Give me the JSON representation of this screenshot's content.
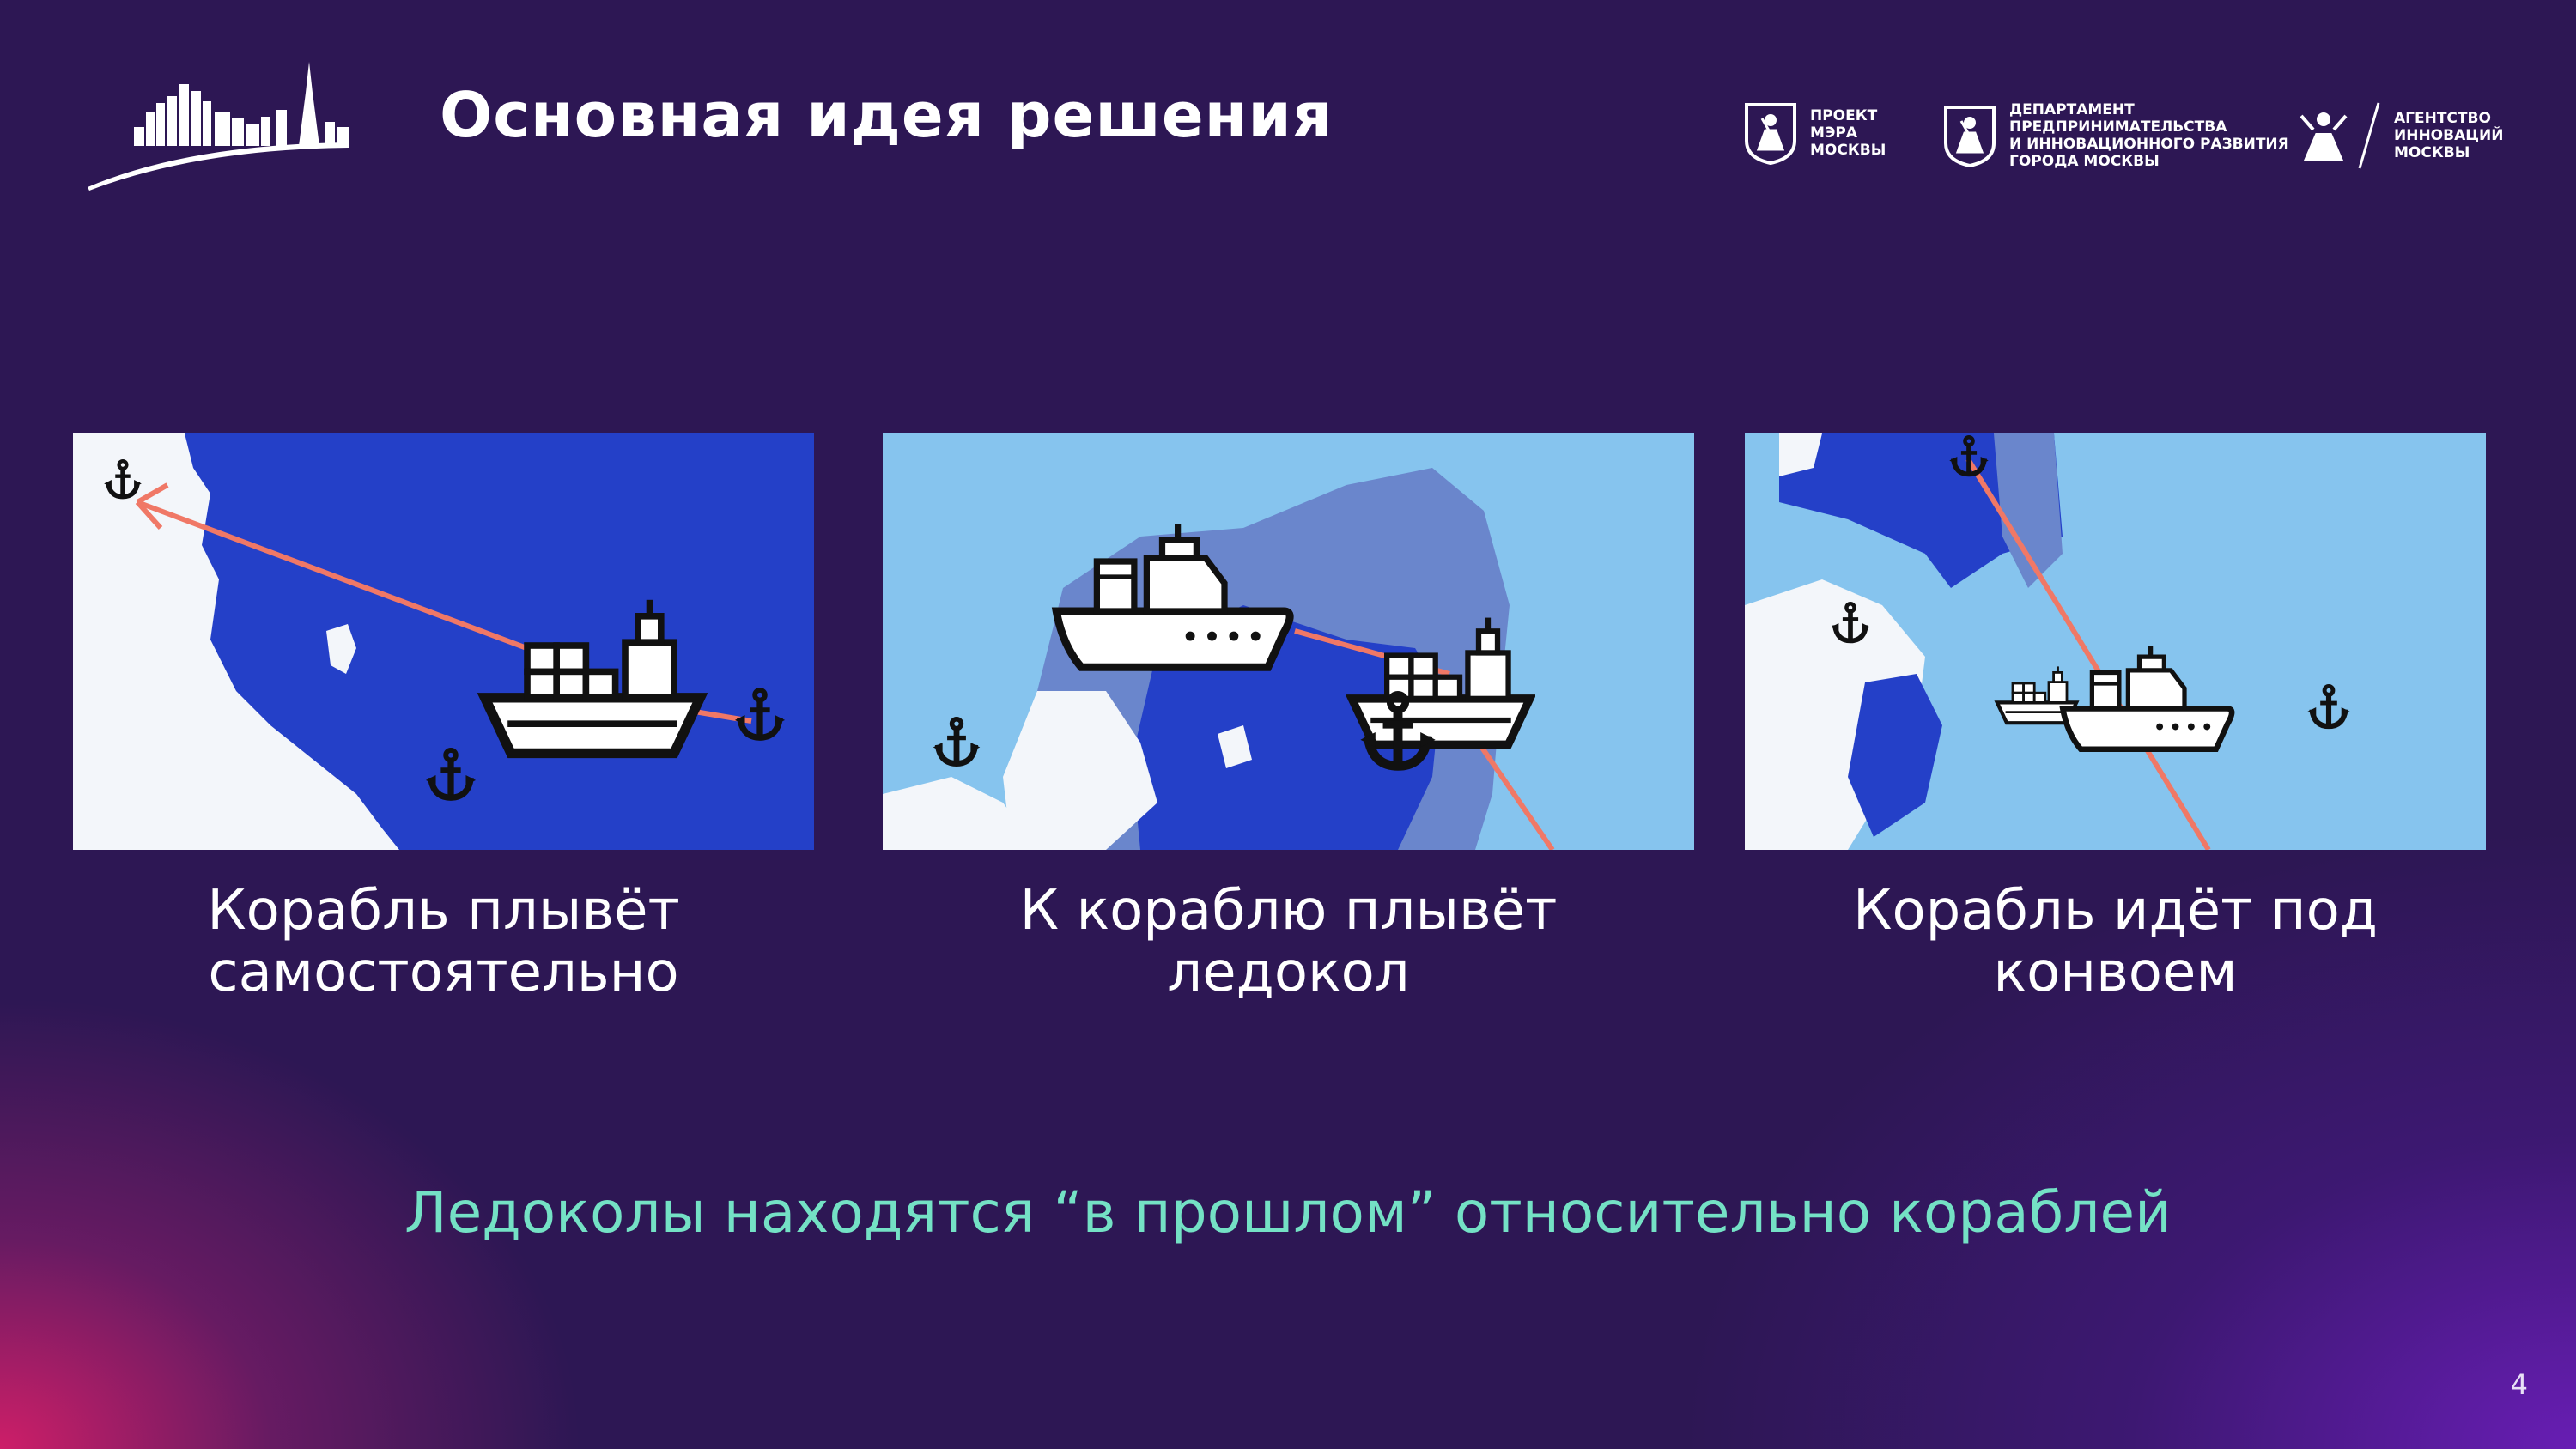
{
  "header": {
    "title": "Основная идея решения",
    "logos": [
      {
        "icon": "moscow-emblem-icon",
        "label": "ПРОЕКТ\nМЭРА\nМОСКВЫ"
      },
      {
        "icon": "moscow-emblem-icon",
        "label": "ДЕПАРТАМЕНТ\nПРЕДПРИНИМАТЕЛЬСТВА\nИ ИННОВАЦИОННОГО РАЗВИТИЯ\nГОРОДА МОСКВЫ"
      },
      {
        "icon": "moscow-emblem-icon",
        "label": "АГЕНТСТВО\nИННОВАЦИЙ\nМОСКВЫ"
      }
    ]
  },
  "panels": [
    {
      "caption_line1": "Корабль плывёт",
      "caption_line2": "самостоятельно"
    },
    {
      "caption_line1": "К кораблю плывёт",
      "caption_line2": "ледокол"
    },
    {
      "caption_line1": "Корабль идёт под",
      "caption_line2": "конвоем"
    }
  ],
  "bottom_text": "Ледоколы находятся “в прошлом” относительно кораблей",
  "page_number": "4",
  "colors": {
    "background": "#2d1754",
    "accent_text": "#74e1c5",
    "deep_water": "#2440c8",
    "light_water": "#86c4ee",
    "route": "#f07866"
  }
}
